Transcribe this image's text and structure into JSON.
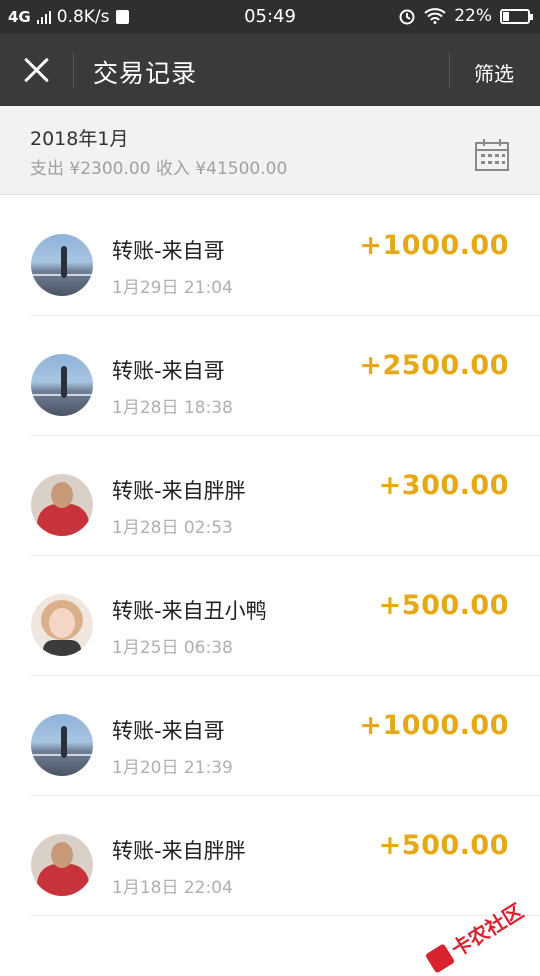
{
  "statusbar": {
    "network": "4G",
    "speed": "0.8K/s",
    "time": "05:49",
    "battery_percent": "22%",
    "battery_level": 0.22
  },
  "navbar": {
    "title": "交易记录",
    "filter_label": "筛选"
  },
  "month": {
    "label": "2018年1月",
    "summary": "支出 ¥2300.00 收入 ¥41500.00"
  },
  "transactions": [
    {
      "title": "转账-来自哥",
      "time": "1月29日 21:04",
      "amount": "+1000.00",
      "avatar": "scenic"
    },
    {
      "title": "转账-来自哥",
      "time": "1月28日 18:38",
      "amount": "+2500.00",
      "avatar": "scenic"
    },
    {
      "title": "转账-来自胖胖",
      "time": "1月28日 02:53",
      "amount": "+300.00",
      "avatar": "red"
    },
    {
      "title": "转账-来自丑小鸭",
      "time": "1月25日 06:38",
      "amount": "+500.00",
      "avatar": "girl"
    },
    {
      "title": "转账-来自哥",
      "time": "1月20日 21:39",
      "amount": "+1000.00",
      "avatar": "scenic"
    },
    {
      "title": "转账-来自胖胖",
      "time": "1月18日 22:04",
      "amount": "+500.00",
      "avatar": "red"
    }
  ],
  "watermark": {
    "text": "卡农社区"
  },
  "colors": {
    "amount": "#e6a915",
    "navbar": "#3a3a3c",
    "statusbar": "#2f2f31"
  }
}
